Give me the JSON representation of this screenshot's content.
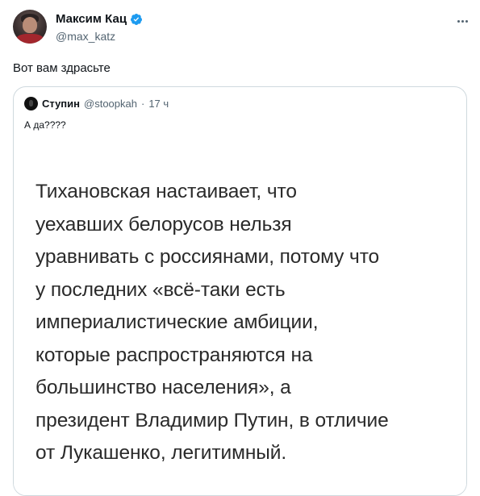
{
  "author": {
    "display_name": "Максим Кац",
    "handle": "@max_katz",
    "verified": true,
    "avatar_icon": "user-avatar",
    "verified_color": "#1d9bf0"
  },
  "tweet": {
    "text": "Вот вам здрасьте"
  },
  "quoted_tweet": {
    "display_name": "Ступин",
    "handle": "@stoopkah",
    "separator": "·",
    "time": "17 ч",
    "text": "А да????",
    "image_text_lines": [
      "Тихановская настаивает, что",
      "уехавших белорусов нельзя",
      "уравнивать с россиянами, потому что",
      "у последних «всё-таки есть",
      "империалистические амбиции,",
      "которые распространяются на",
      "большинство населения», а",
      "президент Владимир Путин, в отличие",
      "от Лукашенко, легитимный."
    ]
  },
  "colors": {
    "text_primary": "#0f1419",
    "text_secondary": "#536471",
    "border": "#cfd9de"
  }
}
